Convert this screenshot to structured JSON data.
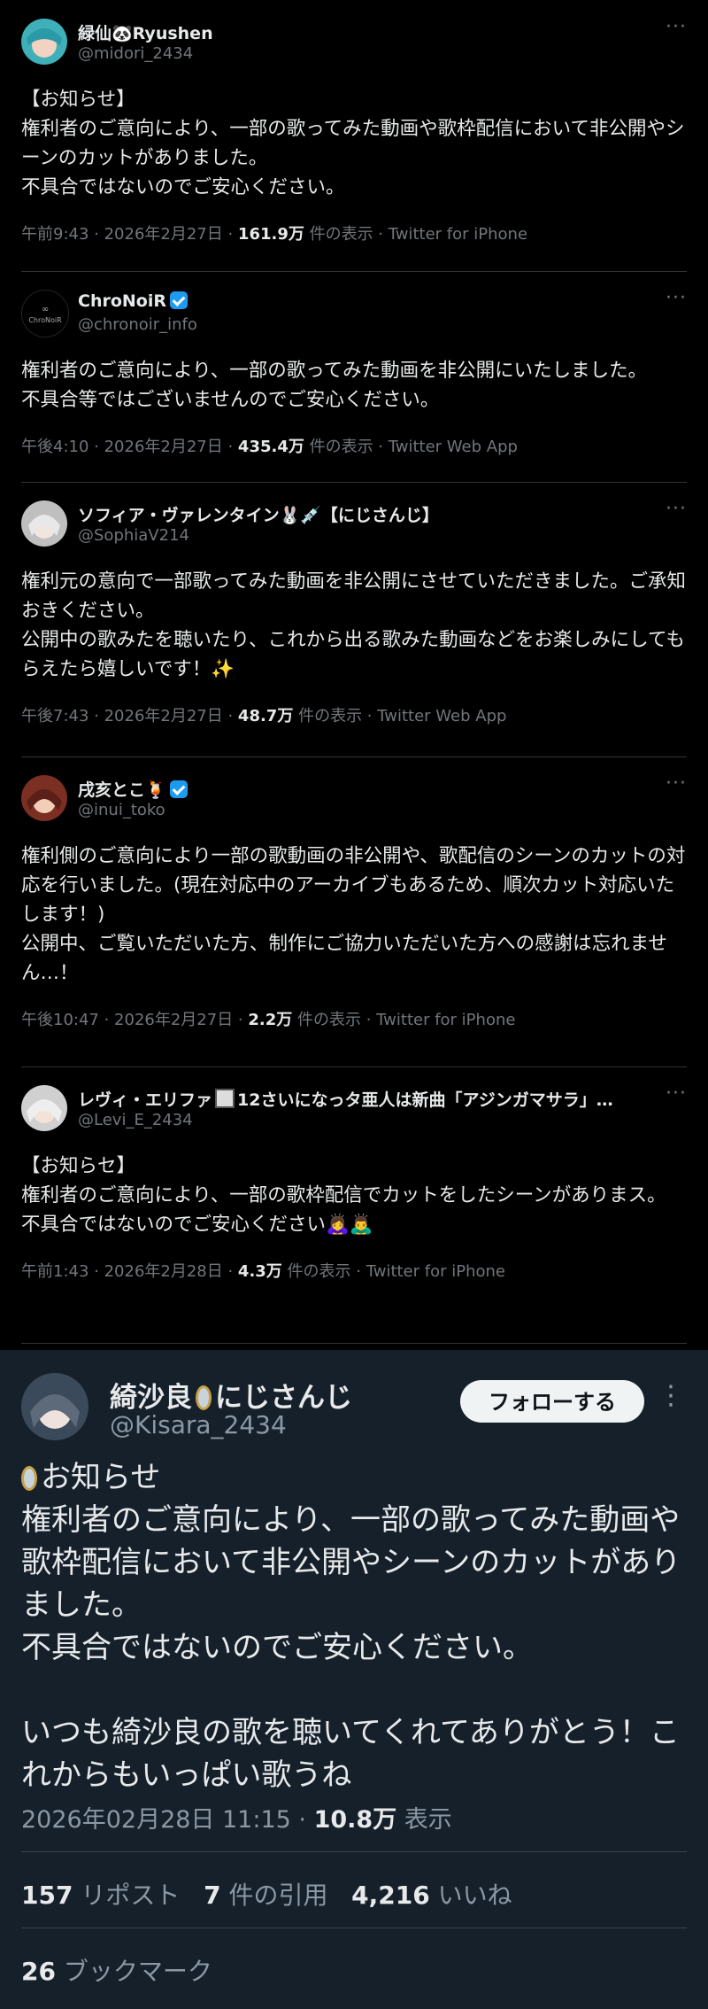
{
  "tweets": [
    {
      "name": "緑仙🐼Ryushen",
      "handle": "@midori_2434",
      "text": "【お知らせ】\n権利者のご意向により、一部の歌ってみた動画や歌枠配信において非公開やシーンのカットがありました。\n不具合ではないのでご安心ください。",
      "time": "午前9:43 · 2026年2月27日 · ",
      "views": "161.9万",
      "views_label": " 件の表示 · ",
      "client": "Twitter for iPhone",
      "avatar_color": "#3fb0b8"
    },
    {
      "name": "ChroNoiR",
      "handle": "@chronoir_info",
      "text": "権利者のご意向により、一部の歌ってみた動画を非公開にいたしました。\n不具合等ではございませんのでご安心ください。",
      "time": "午後4:10 · 2026年2月27日 · ",
      "views": "435.4万",
      "views_label": " 件の表示 · ",
      "client": "Twitter Web App",
      "avatar_color": "#000000",
      "avatar_text": "ChroNoiR"
    },
    {
      "name": "ソフィア・ヴァレンタイン🐰💉【にじさんじ】",
      "handle": "@SophiaV214",
      "text": "権利元の意向で一部歌ってみた動画を非公開にさせていただきました。ご承知おきください。\n公開中の歌みたを聴いたり、これから出る歌みた動画などをお楽しみにしてもらえたら嬉しいです！",
      "sparkle": "✨",
      "time": "午後7:43 · 2026年2月27日 · ",
      "views": "48.7万",
      "views_label": " 件の表示 · ",
      "client": "Twitter Web App",
      "avatar_color": "#c8c8c8"
    },
    {
      "name": "戌亥とこ🍹",
      "handle": "@inui_toko",
      "text": "権利側のご意向により一部の歌動画の非公開や、歌配信のシーンのカットの対応を行いました。(現在対応中のアーカイブもあるため、順次カット対応いたします！)\n公開中、ご覧いただいた方、制作にご協力いただいた方への感謝は忘れません…！",
      "time": "午後10:47 · 2026年2月27日 · ",
      "views": "2.2万",
      "views_label": " 件の表示 · ",
      "client": "Twitter for iPhone",
      "avatar_color": "#8a3a2a"
    },
    {
      "name": "レヴィ・エリファ",
      "name_suffix": "12さいになっタ亜人は新曲「アジンガマサラ」…",
      "handle": "@Levi_E_2434",
      "text": "【お知らセ】\n権利者のご意向により、一部の歌枠配信でカットをしたシーンがありまス。\n不具合ではないのでご安心ください🙇‍♀️🙇‍♂️",
      "time": "午前1:43 · 2026年2月28日 · ",
      "views": "4.3万",
      "views_label": " 件の表示 · ",
      "client": "Twitter for iPhone",
      "avatar_color": "#d8d8d8"
    }
  ],
  "featured": {
    "name_a": "綺沙良",
    "name_b": "にじさんじ",
    "handle": "@Kisara_2434",
    "follow_label": "フォローする",
    "title": "お知らせ",
    "text": "権利者のご意向により、一部の歌ってみた動画や歌枠配信において非公開やシーンのカットがありました。\n不具合ではないのでご安心ください。\n\nいつも綺沙良の歌を聴いてくれてありがとう！これからもいっぱい歌うね",
    "time": "2026年02月28日 11:15 · ",
    "views": "10.8万",
    "views_label": " 表示",
    "reposts": "157",
    "reposts_label": " リポスト",
    "quotes": "7",
    "quotes_label": " 件の引用",
    "likes": "4,216",
    "likes_label": " いいね",
    "bookmarks": "26",
    "bookmarks_label": " ブックマーク",
    "more": "⋮"
  },
  "more_icon": "···"
}
